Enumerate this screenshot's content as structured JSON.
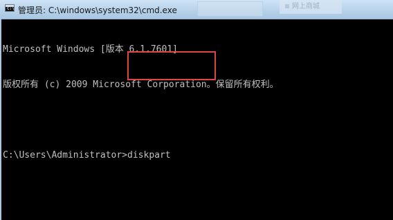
{
  "window": {
    "title": "管理员: C:\\windows\\system32\\cmd.exe",
    "icon": "cmd-icon",
    "background_tab_label": "网上商城"
  },
  "console": {
    "lines": [
      "Microsoft Windows [版本 6.1.7601]",
      "版权所有 (c) 2009 Microsoft Corporation。保留所有权利。",
      "",
      "C:\\Users\\Administrator>diskpart"
    ],
    "prompt": "C:\\Users\\Administrator>",
    "command": "diskpart"
  },
  "colors": {
    "console_bg": "#000000",
    "console_text": "#c0c0c0",
    "titlebar": "#b7d2ea",
    "highlight": "#e0463f"
  }
}
